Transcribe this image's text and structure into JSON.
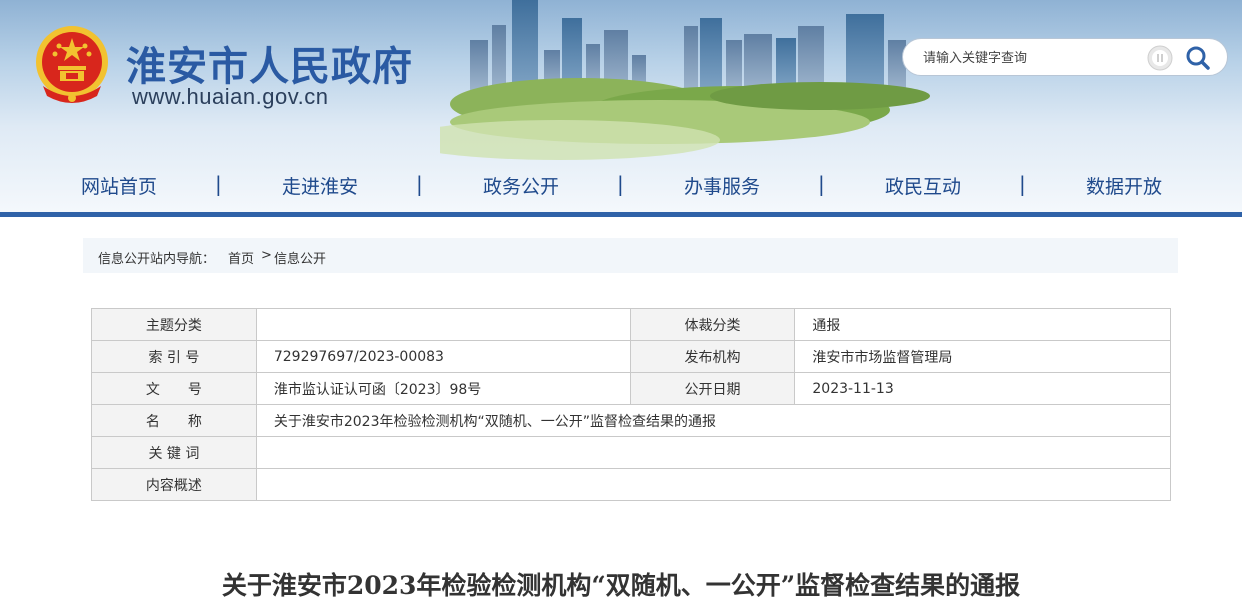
{
  "header": {
    "site_title": "淮安市人民政府",
    "site_url": "www.huaian.gov.cn",
    "search": {
      "placeholder": "请输入关键字查询"
    }
  },
  "nav": {
    "items": [
      "网站首页",
      "走进淮安",
      "政务公开",
      "办事服务",
      "政民互动",
      "数据开放"
    ],
    "separator": "|"
  },
  "breadcrumb": {
    "label": "信息公开站内导航：",
    "home": "首页",
    "sep": ">",
    "current": "信息公开"
  },
  "meta": {
    "topic_label": "主题分类",
    "topic_value": "",
    "genre_label": "体裁分类",
    "genre_value": "通报",
    "index_label": "索 引 号",
    "index_value": "729297697/2023-00083",
    "publisher_label": "发布机构",
    "publisher_value": "淮安市市场监督管理局",
    "docno_label": "文　　号",
    "docno_value": "淮市监认证认可函〔2023〕98号",
    "date_label": "公开日期",
    "date_value": "2023-11-13",
    "name_label": "名　　称",
    "name_value": "关于淮安市2023年检验检测机构“双随机、一公开”监督检查结果的通报",
    "keywords_label": "关 键 词",
    "keywords_value": "",
    "summary_label": "内容概述",
    "summary_value": ""
  },
  "article": {
    "title": "关于淮安市2023年检验检测机构“双随机、一公开”监督检查结果的通报"
  },
  "colors": {
    "brand_blue": "#2a5aa3",
    "nav_text": "#1f4a8c",
    "nav_bar": "#2f62a8",
    "emblem_red": "#d8261c",
    "emblem_gold": "#f2c230"
  }
}
